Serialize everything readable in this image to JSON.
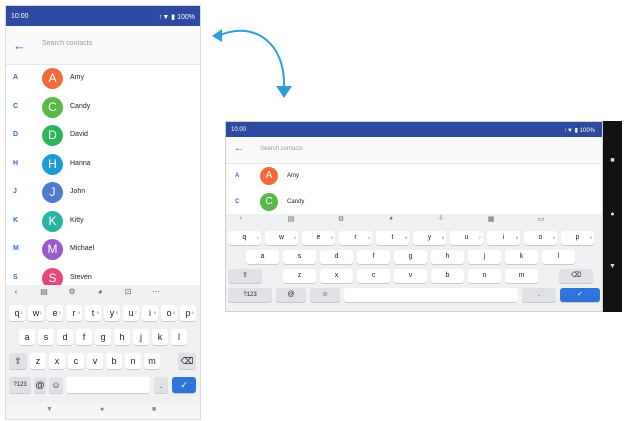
{
  "status": {
    "time": "10:00",
    "battery": "100%"
  },
  "search": {
    "placeholder": "Search contacts"
  },
  "contacts": [
    {
      "letter": "A",
      "initial": "A",
      "name": "Amy",
      "color": "#f06a3c"
    },
    {
      "letter": "C",
      "initial": "C",
      "name": "Candy",
      "color": "#57b947"
    },
    {
      "letter": "D",
      "initial": "D",
      "name": "David",
      "color": "#2fb35a"
    },
    {
      "letter": "H",
      "initial": "H",
      "name": "Hanna",
      "color": "#1e9bd7"
    },
    {
      "letter": "J",
      "initial": "J",
      "name": "John",
      "color": "#4f7ad0"
    },
    {
      "letter": "K",
      "initial": "K",
      "name": "Kitty",
      "color": "#2ab3a3"
    },
    {
      "letter": "M",
      "initial": "M",
      "name": "Michael",
      "color": "#9a5bc6"
    },
    {
      "letter": "S",
      "initial": "S",
      "name": "Steven",
      "color": "#e8457a"
    }
  ],
  "keyboard": {
    "row1": [
      "q",
      "w",
      "e",
      "r",
      "t",
      "y",
      "u",
      "i",
      "o",
      "p"
    ],
    "row1_digits": [
      "1",
      "2",
      "3",
      "4",
      "5",
      "6",
      "7",
      "8",
      "9",
      "0"
    ],
    "row2": [
      "a",
      "s",
      "d",
      "f",
      "g",
      "h",
      "j",
      "k",
      "l"
    ],
    "row3": [
      "z",
      "x",
      "c",
      "v",
      "b",
      "n",
      "m"
    ],
    "symbols_key": "?123",
    "at_key": "@",
    "emoji_key": "☺",
    "period_key": ".",
    "enter_key": "✓",
    "shift_key": "⇧",
    "delete_key": "⌫",
    "toolbar_portrait": [
      "‹",
      "▤",
      "⚙",
      "◕",
      "⊡",
      "⋯"
    ],
    "toolbar_landscape": [
      "‹",
      "▤",
      "⚙",
      "◕",
      "·I·",
      "▦",
      "▭"
    ]
  },
  "nav": {
    "back": "▼",
    "home": "●",
    "recents": "■"
  },
  "colors": {
    "status_bar": "#2b4aa0",
    "accent": "#2f68d8",
    "arrow": "#2a9fd8"
  }
}
